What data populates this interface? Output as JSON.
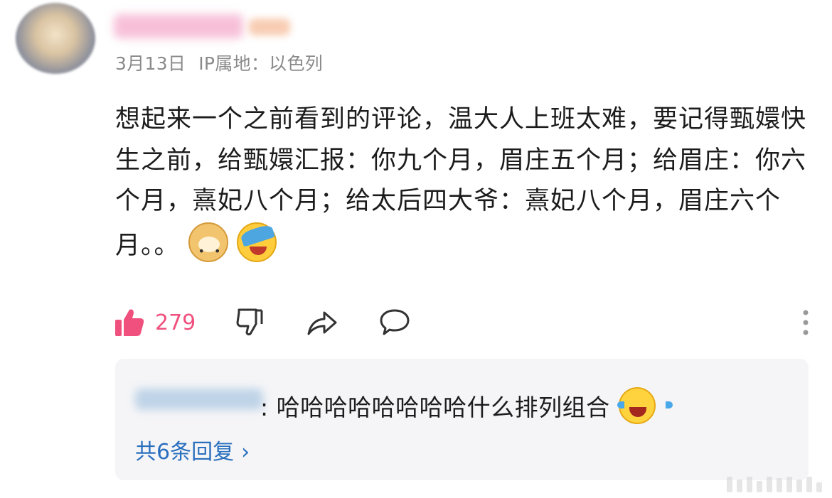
{
  "comment": {
    "date": "3月13日",
    "ip_location": "IP属地：以色列",
    "text": "想起来一个之前看到的评论，温大人上班太难，要记得甄嬛快生之前，给甄嬛汇报：你九个月，眉庄五个月；给眉庄：你六个月，熹妃八个月；给太后四大爷：熹妃八个月，眉庄六个月。。",
    "emojis": [
      "doge-icon",
      "face-covering-icon"
    ],
    "like_count": "279"
  },
  "actions": {
    "icons": [
      "thumbs-up-icon",
      "thumbs-down-icon",
      "share-icon",
      "comment-icon",
      "more-icon"
    ]
  },
  "reply": {
    "text": ": 哈哈哈哈哈哈哈哈什么排列组合",
    "emoji": "laughing-tears-icon",
    "view_replies": "共6条回复",
    "chevron": "›"
  },
  "colors": {
    "like": "#f0507e",
    "link": "#2a6fbd",
    "meta": "#8a8a8a",
    "reply_bg": "#f5f5f7"
  }
}
